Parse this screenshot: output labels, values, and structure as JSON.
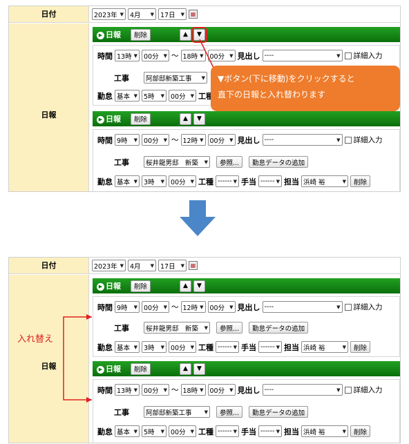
{
  "date": {
    "label": "日付",
    "year": "2023年",
    "month": "4月",
    "day": "17日"
  },
  "nippo_label": "日報",
  "group_label": "日報",
  "delete_label": "削除",
  "up": "▲",
  "down": "▼",
  "time": {
    "label": "時間",
    "sep": "〜"
  },
  "midashi": {
    "label": "見出し",
    "value": "----"
  },
  "detail": "詳細入力",
  "kouji": {
    "label": "工事",
    "ref": "参照...",
    "add": "勤怠データの追加"
  },
  "kintai": {
    "label": "勤怠",
    "type": "基本"
  },
  "koushu": {
    "label": "工種",
    "value": "------"
  },
  "teate": {
    "label": "手当",
    "value": "------"
  },
  "tanto": {
    "label": "担当",
    "value": "浜崎 裕"
  },
  "entryA": {
    "from_h": "13時",
    "from_m": "00分",
    "to_h": "18時",
    "to_m": "00分",
    "project": "阿部邸新築工事",
    "k_h": "5時",
    "k_m": "00分"
  },
  "entryB": {
    "from_h": "9時",
    "from_m": "00分",
    "to_h": "12時",
    "to_m": "00分",
    "project": "桜井龍男邸　新築",
    "k_h": "3時",
    "k_m": "00分"
  },
  "callout": {
    "line1": "▼ボタン(下に移動)をクリックすると",
    "line2": "直下の日報と入れ替わります"
  },
  "swap_label": "入れ替え",
  "colors": {
    "green": "#0b7a0b",
    "label_bg": "#fdf0c0",
    "callout": "#ee7c2c",
    "arrow": "#4a86c8",
    "red": "#e02020"
  }
}
